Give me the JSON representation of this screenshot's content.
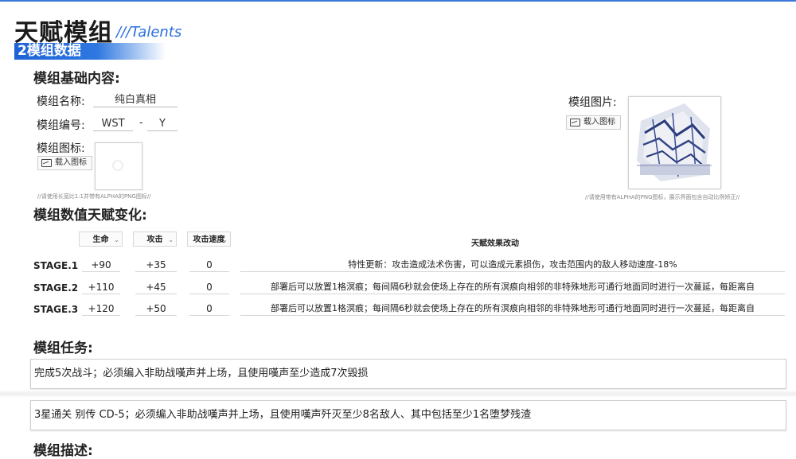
{
  "header": {
    "title": "天赋模组",
    "title_en": "///Talents",
    "subtitle": "2模组数据"
  },
  "basic": {
    "heading": "模组基础内容:",
    "name_label": "模组名称:",
    "name_value": "纯白真相",
    "code_label": "模组编号:",
    "code_prefix": "WST",
    "code_sep": "-",
    "code_suffix": "Y",
    "icon_label": "模组图标:",
    "icon_button": "载入图标",
    "icon_note": "//请使用长宽比1:1并带有ALPHA的PNG图标//",
    "image_label": "模组图片:",
    "image_button": "载入图标",
    "image_note": "//请使用带有ALPHA的PNG图标，展示界面包含自动比例矫正//"
  },
  "stats": {
    "heading": "模组数值天赋变化:",
    "columns": [
      "生命",
      "攻击",
      "攻击速度"
    ],
    "effect_header": "天赋效果改动",
    "rows": [
      {
        "stage": "STAGE.1",
        "hp": "+90",
        "atk": "+35",
        "aspd": "0",
        "effect": "特性更新：攻击造成法术伤害，可以造成元素损伤，攻击范围内的敌人移动速度-18%"
      },
      {
        "stage": "STAGE.2",
        "hp": "+110",
        "atk": "+45",
        "aspd": "0",
        "effect": "部署后可以放置1格溟痕；每间隔6秒就会使场上存在的所有溟痕向相邻的非特殊地形可通行地面同时进行一次蔓延，每距离自"
      },
      {
        "stage": "STAGE.3",
        "hp": "+120",
        "atk": "+50",
        "aspd": "0",
        "effect": "部署后可以放置1格溟痕；每间隔6秒就会使场上存在的所有溟痕向相邻的非特殊地形可通行地面同时进行一次蔓延，每距离自"
      }
    ]
  },
  "tasks": {
    "heading": "模组任务:",
    "items": [
      "完成5次战斗；必须编入非助战嘆声并上场，且使用嘆声至少造成7次毁损",
      "3星通关 别传 CD-5；必须编入非助战嘆声并上场，且使用嘆声歼灭至少8名敌人、其中包括至少1名堕梦残渣"
    ]
  },
  "description": {
    "heading": "模组描述:"
  },
  "colors": {
    "accent": "#2a6fdb",
    "banner": "#1e63d6"
  }
}
